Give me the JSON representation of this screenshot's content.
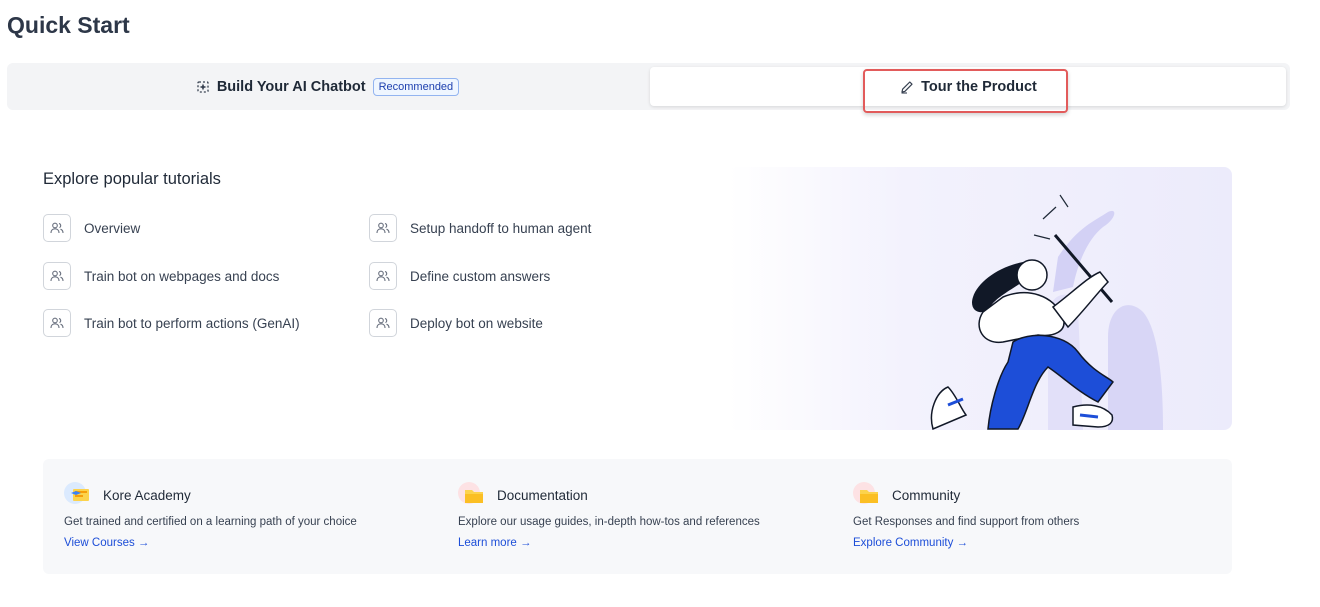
{
  "page": {
    "title": "Quick Start"
  },
  "tabs": {
    "build": {
      "label": "Build Your AI Chatbot",
      "badge": "Recommended",
      "icon": "sparkle-icon"
    },
    "tour": {
      "label": "Tour the Product",
      "icon": "pencil-icon",
      "selected": true
    }
  },
  "tutorials": {
    "title": "Explore popular tutorials",
    "items": [
      {
        "label": "Overview",
        "icon": "users-icon"
      },
      {
        "label": "Setup handoff to human agent",
        "icon": "users-icon"
      },
      {
        "label": "Train bot on webpages and docs",
        "icon": "users-icon"
      },
      {
        "label": "Define custom answers",
        "icon": "users-icon"
      },
      {
        "label": "Train bot to perform actions (GenAI)",
        "icon": "users-icon"
      },
      {
        "label": "Deploy bot on website",
        "icon": "users-icon"
      }
    ]
  },
  "resources": [
    {
      "title": "Kore Academy",
      "description": "Get trained and certified on a learning path of your choice",
      "link": "View Courses →",
      "icon": "academy-icon"
    },
    {
      "title": "Documentation",
      "description": "Explore our usage guides, in-depth how-tos and references",
      "link": "Learn more →",
      "icon": "folder-icon"
    },
    {
      "title": "Community",
      "description": "Get Responses and find support from others",
      "link": "Explore Community →",
      "icon": "folder-icon"
    }
  ],
  "colors": {
    "accent": "#2563eb",
    "highlight": "#e25b5b",
    "illustration_blue": "#1d4ed8"
  }
}
